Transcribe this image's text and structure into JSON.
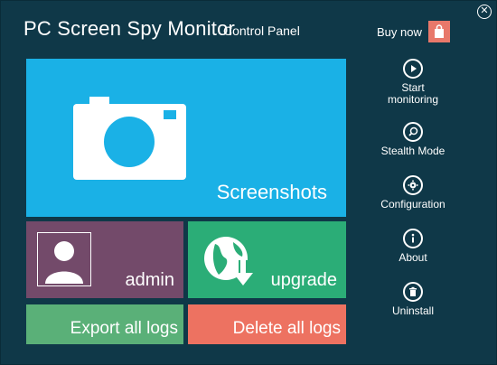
{
  "header": {
    "title": "PC Screen Spy Monitor",
    "subtitle": "Control Panel",
    "buy_label": "Buy now"
  },
  "tiles": {
    "screenshots": "Screenshots",
    "admin": "admin",
    "upgrade": "upgrade",
    "export": "Export all logs",
    "delete": "Delete all logs"
  },
  "sidebar": {
    "items": [
      {
        "label": "Start\nmonitoring",
        "icon": "play-icon"
      },
      {
        "label": "Stealth Mode",
        "icon": "search-icon"
      },
      {
        "label": "Configuration",
        "icon": "gear-icon"
      },
      {
        "label": "About",
        "icon": "info-icon"
      },
      {
        "label": "Uninstall",
        "icon": "trash-icon"
      }
    ]
  },
  "colors": {
    "background": "#0f3848",
    "screenshots_tile": "#1ab1e6",
    "admin_tile": "#734a6a",
    "upgrade_tile": "#2bad77",
    "export_tile": "#5ab078",
    "delete_tile": "#ed7261",
    "buy_icon": "#e8786a"
  }
}
